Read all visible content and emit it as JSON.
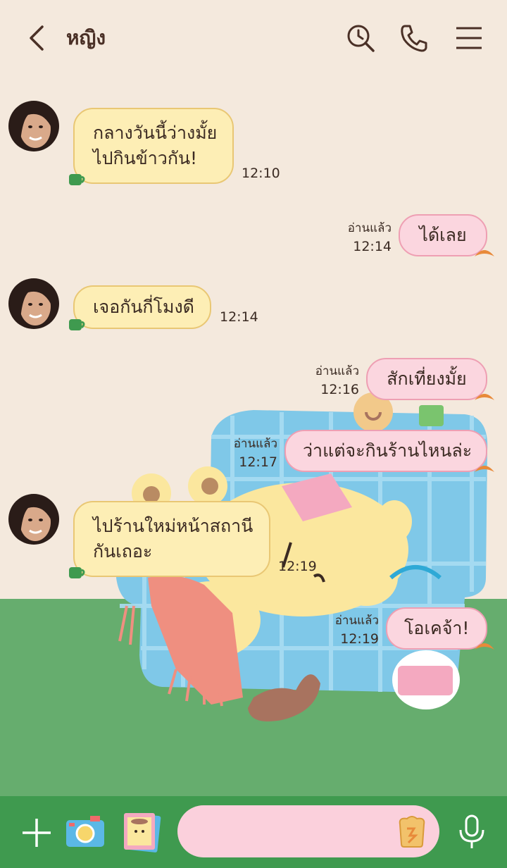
{
  "header": {
    "title": "หญิง",
    "icons": [
      "back-arrow-icon",
      "search-history-icon",
      "phone-icon",
      "menu-icon"
    ]
  },
  "colors": {
    "background": "#f4e9dd",
    "incoming_bubble": "#fdeeb5",
    "outgoing_bubble": "#fbd6df",
    "grass": "#66ad6e",
    "bottom_bar": "#3f9a4f",
    "input_field": "#fbd0dc"
  },
  "messages": [
    {
      "direction": "in",
      "lines": [
        "กลางวันนี้ว่างมั้ย",
        "ไปกินข้าวกัน!"
      ],
      "time": "12:10"
    },
    {
      "direction": "out",
      "lines": [
        "ได้เลย"
      ],
      "read": "อ่านแล้ว",
      "time": "12:14"
    },
    {
      "direction": "in",
      "lines": [
        "เจอกันกี่โมงดี"
      ],
      "time": "12:14"
    },
    {
      "direction": "out",
      "lines": [
        "สักเที่ยงมั้ย"
      ],
      "read": "อ่านแล้ว",
      "time": "12:16"
    },
    {
      "direction": "out",
      "lines": [
        "ว่าแต่จะกินร้านไหนล่ะ"
      ],
      "read": "อ่านแล้ว",
      "time": "12:17"
    },
    {
      "direction": "in",
      "lines": [
        "ไปร้านใหม่หน้าสถานี",
        "กันเถอะ"
      ],
      "time": "12:19"
    },
    {
      "direction": "out",
      "lines": [
        "โอเคจ้า!"
      ],
      "read": "อ่านแล้ว",
      "time": "12:19"
    }
  ],
  "bottom_bar": {
    "icons": [
      "plus-icon",
      "camera-icon",
      "photo-icon",
      "toast-sticker-icon",
      "microphone-icon"
    ],
    "input_placeholder": ""
  }
}
